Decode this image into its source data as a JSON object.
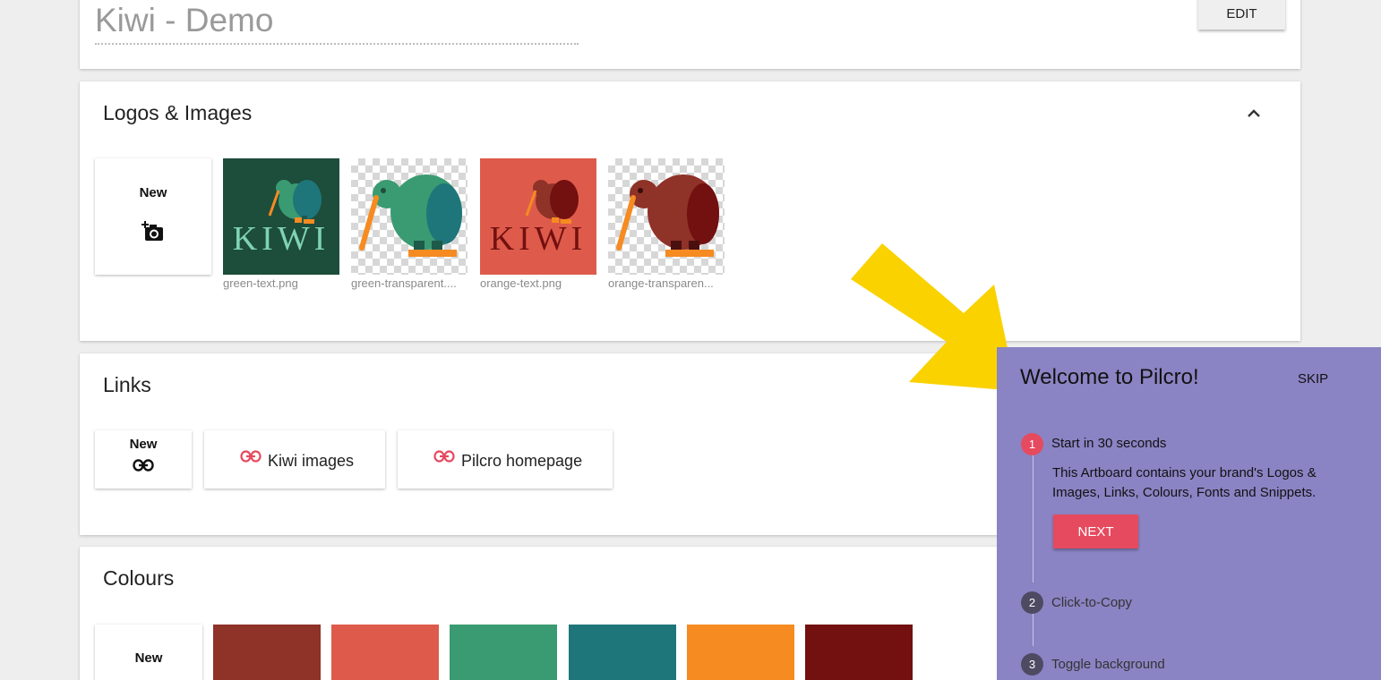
{
  "header": {
    "title": "Kiwi - Demo",
    "edit_label": "EDIT"
  },
  "logos": {
    "title": "Logos & Images",
    "new_label": "New",
    "images": [
      {
        "caption": "green-text.png",
        "background": "#1d4d3b"
      },
      {
        "caption": "green-transparent....",
        "background": "checker"
      },
      {
        "caption": "orange-text.png",
        "background": "#de5b4b"
      },
      {
        "caption": "orange-transparen...",
        "background": "checker"
      }
    ],
    "image_text": "KIWI"
  },
  "links": {
    "title": "Links",
    "new_label": "New",
    "items": [
      {
        "label": "Kiwi images"
      },
      {
        "label": "Pilcro homepage"
      }
    ]
  },
  "colours": {
    "title": "Colours",
    "new_label": "New",
    "swatches": [
      "#8f3228",
      "#de5b4b",
      "#3a9b72",
      "#1e767a",
      "#f58b21",
      "#731010"
    ]
  },
  "welcome": {
    "title": "Welcome to Pilcro!",
    "skip_label": "SKIP",
    "next_label": "NEXT",
    "steps": [
      {
        "number": "1",
        "label": "Start in 30 seconds",
        "description": "This Artboard contains your brand's Logos & Images, Links, Colours, Fonts and Snippets."
      },
      {
        "number": "2",
        "label": "Click-to-Copy"
      },
      {
        "number": "3",
        "label": "Toggle background"
      }
    ]
  },
  "colors": {
    "accent_red": "#e64a5e",
    "panel": "#8a84c4",
    "arrow": "#fad200"
  }
}
